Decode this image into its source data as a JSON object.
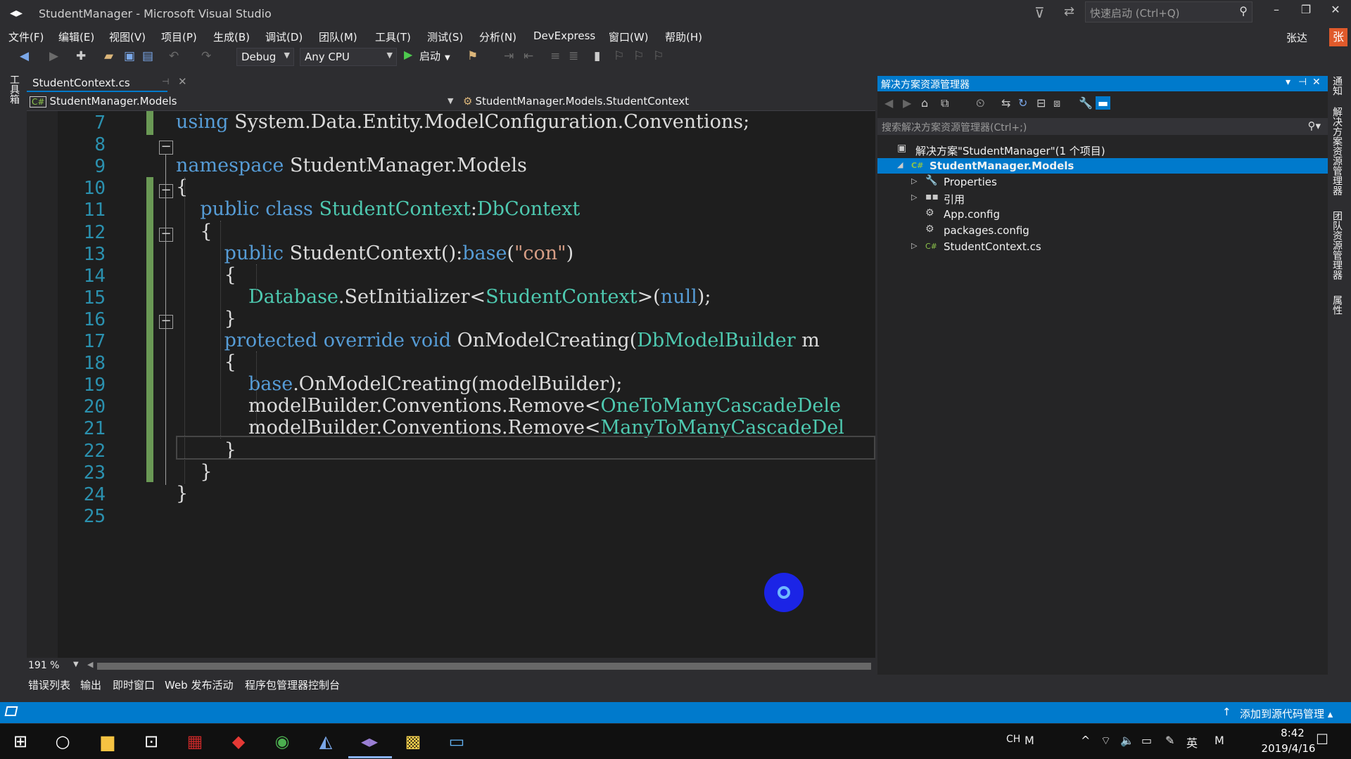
{
  "window": {
    "title": "StudentManager - Microsoft Visual Studio",
    "quick_launch_placeholder": "快速启动 (Ctrl+Q)",
    "user_name": "张达",
    "user_avatar": "张"
  },
  "menu": [
    "文件(F)",
    "编辑(E)",
    "视图(V)",
    "项目(P)",
    "生成(B)",
    "调试(D)",
    "团队(M)",
    "工具(T)",
    "测试(S)",
    "分析(N)",
    "DevExpress",
    "窗口(W)",
    "帮助(H)"
  ],
  "toolbar": {
    "configuration": "Debug",
    "platform": "Any CPU",
    "start_label": "启动"
  },
  "left_strip": {
    "toolbox_label": "工具箱"
  },
  "editor": {
    "tab_name": "StudentContext.cs",
    "nav_project": "StudentManager.Models",
    "nav_class": "StudentManager.Models.StudentContext",
    "zoom": "191 %",
    "line_numbers": [
      "7",
      "8",
      "9",
      "10",
      "11",
      "12",
      "13",
      "14",
      "15",
      "16",
      "17",
      "18",
      "19",
      "20",
      "21",
      "22",
      "23",
      "24",
      "25"
    ],
    "lines": [
      {
        "segments": [
          {
            "t": "using",
            "c": "kw"
          },
          {
            "t": " System.Data.Entity.ModelConfiguration.Conventions;",
            "c": ""
          }
        ]
      },
      {
        "segments": []
      },
      {
        "segments": [
          {
            "t": "namespace",
            "c": "kw"
          },
          {
            "t": " StudentManager.Models",
            "c": ""
          }
        ]
      },
      {
        "segments": [
          {
            "t": "{",
            "c": ""
          }
        ]
      },
      {
        "segments": [
          {
            "t": "    ",
            "c": ""
          },
          {
            "t": "public",
            "c": "kw"
          },
          {
            "t": " ",
            "c": ""
          },
          {
            "t": "class",
            "c": "kw"
          },
          {
            "t": " ",
            "c": ""
          },
          {
            "t": "StudentContext",
            "c": "ty"
          },
          {
            "t": ":",
            "c": ""
          },
          {
            "t": "DbContext",
            "c": "ty"
          }
        ]
      },
      {
        "segments": [
          {
            "t": "    {",
            "c": ""
          }
        ]
      },
      {
        "segments": [
          {
            "t": "        ",
            "c": ""
          },
          {
            "t": "public",
            "c": "kw"
          },
          {
            "t": " StudentContext():",
            "c": ""
          },
          {
            "t": "base",
            "c": "kw"
          },
          {
            "t": "(",
            "c": ""
          },
          {
            "t": "\"con\"",
            "c": "str"
          },
          {
            "t": ")",
            "c": ""
          }
        ]
      },
      {
        "segments": [
          {
            "t": "        {",
            "c": ""
          }
        ]
      },
      {
        "segments": [
          {
            "t": "            ",
            "c": ""
          },
          {
            "t": "Database",
            "c": "ty"
          },
          {
            "t": ".SetInitializer<",
            "c": ""
          },
          {
            "t": "StudentContext",
            "c": "ty"
          },
          {
            "t": ">(",
            "c": ""
          },
          {
            "t": "null",
            "c": "kw"
          },
          {
            "t": ");",
            "c": ""
          }
        ]
      },
      {
        "segments": [
          {
            "t": "        }",
            "c": ""
          }
        ]
      },
      {
        "segments": [
          {
            "t": "        ",
            "c": ""
          },
          {
            "t": "protected",
            "c": "kw"
          },
          {
            "t": " ",
            "c": ""
          },
          {
            "t": "override",
            "c": "kw"
          },
          {
            "t": " ",
            "c": ""
          },
          {
            "t": "void",
            "c": "kw"
          },
          {
            "t": " OnModelCreating(",
            "c": ""
          },
          {
            "t": "DbModelBuilder",
            "c": "ty"
          },
          {
            "t": " m",
            "c": ""
          }
        ]
      },
      {
        "segments": [
          {
            "t": "        {",
            "c": ""
          }
        ]
      },
      {
        "segments": [
          {
            "t": "            ",
            "c": ""
          },
          {
            "t": "base",
            "c": "kw"
          },
          {
            "t": ".OnModelCreating(modelBuilder);",
            "c": ""
          }
        ]
      },
      {
        "segments": [
          {
            "t": "            modelBuilder.Conventions.Remove<",
            "c": ""
          },
          {
            "t": "OneToManyCascadeDele",
            "c": "ty"
          }
        ]
      },
      {
        "segments": [
          {
            "t": "            modelBuilder.Conventions.Remove<",
            "c": ""
          },
          {
            "t": "ManyToManyCascadeDel",
            "c": "ty"
          }
        ]
      },
      {
        "segments": [
          {
            "t": "        }",
            "c": ""
          }
        ]
      },
      {
        "segments": [
          {
            "t": "    }",
            "c": ""
          }
        ]
      },
      {
        "segments": [
          {
            "t": "}",
            "c": ""
          }
        ]
      },
      {
        "segments": []
      }
    ]
  },
  "solution_explorer": {
    "title": "解决方案资源管理器",
    "search_placeholder": "搜索解决方案资源管理器(Ctrl+;)",
    "tree": [
      {
        "label": "解决方案\"StudentManager\"(1 个项目)",
        "icon": "solution-icon",
        "arrow": "",
        "indent": 0,
        "selected": false
      },
      {
        "label": "StudentManager.Models",
        "icon": "csharp-project-icon",
        "arrow": "expanded",
        "indent": 1,
        "selected": true
      },
      {
        "label": "Properties",
        "icon": "wrench-icon",
        "arrow": "collapsed",
        "indent": 2,
        "selected": false
      },
      {
        "label": "引用",
        "icon": "references-icon",
        "arrow": "collapsed",
        "indent": 2,
        "selected": false
      },
      {
        "label": "App.config",
        "icon": "config-file-icon",
        "arrow": "",
        "indent": 2,
        "selected": false
      },
      {
        "label": "packages.config",
        "icon": "config-file-icon",
        "arrow": "",
        "indent": 2,
        "selected": false
      },
      {
        "label": "StudentContext.cs",
        "icon": "csharp-file-icon",
        "arrow": "collapsed",
        "indent": 2,
        "selected": false
      }
    ]
  },
  "right_tabs": [
    "通知",
    "解决方案资源管理器",
    "团队资源管理器",
    "属性"
  ],
  "bottom_tabs": [
    "错误列表",
    "输出",
    "即时窗口",
    "Web 发布活动",
    "程序包管理器控制台"
  ],
  "status": {
    "source_control": "添加到源代码管理"
  },
  "taskbar": {
    "ime_lang": "CH",
    "ime_mode": "英",
    "time": "8:42",
    "date": "2019/4/16"
  },
  "colors": {
    "accent": "#007acc",
    "keyword": "#569cd6",
    "type": "#4ec9b0",
    "string": "#d69d85",
    "line_number": "#2b91af",
    "change_bar": "#6a9955"
  }
}
